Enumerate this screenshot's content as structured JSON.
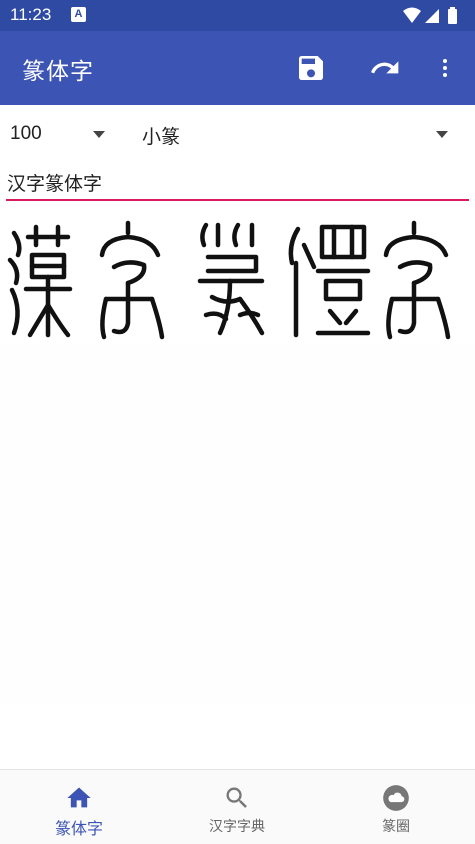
{
  "status": {
    "time": "11:23",
    "badge": "A"
  },
  "appbar": {
    "title": "篆体字",
    "icons": [
      "save-icon",
      "undo-icon",
      "more-vert-icon"
    ]
  },
  "controls": {
    "size_value": "100",
    "font_value": "小篆"
  },
  "input": {
    "value": "汉字篆体字"
  },
  "preview": {
    "text": "漢字篆體字"
  },
  "nav": {
    "items": [
      {
        "label": "篆体字",
        "icon": "home-icon",
        "active": true
      },
      {
        "label": "汉字字典",
        "icon": "search-icon",
        "active": false
      },
      {
        "label": "篆圈",
        "icon": "cloud-icon",
        "active": false
      }
    ]
  },
  "colors": {
    "primary": "#3c55b4",
    "status": "#2f4aa3",
    "accent": "#d81b60"
  }
}
